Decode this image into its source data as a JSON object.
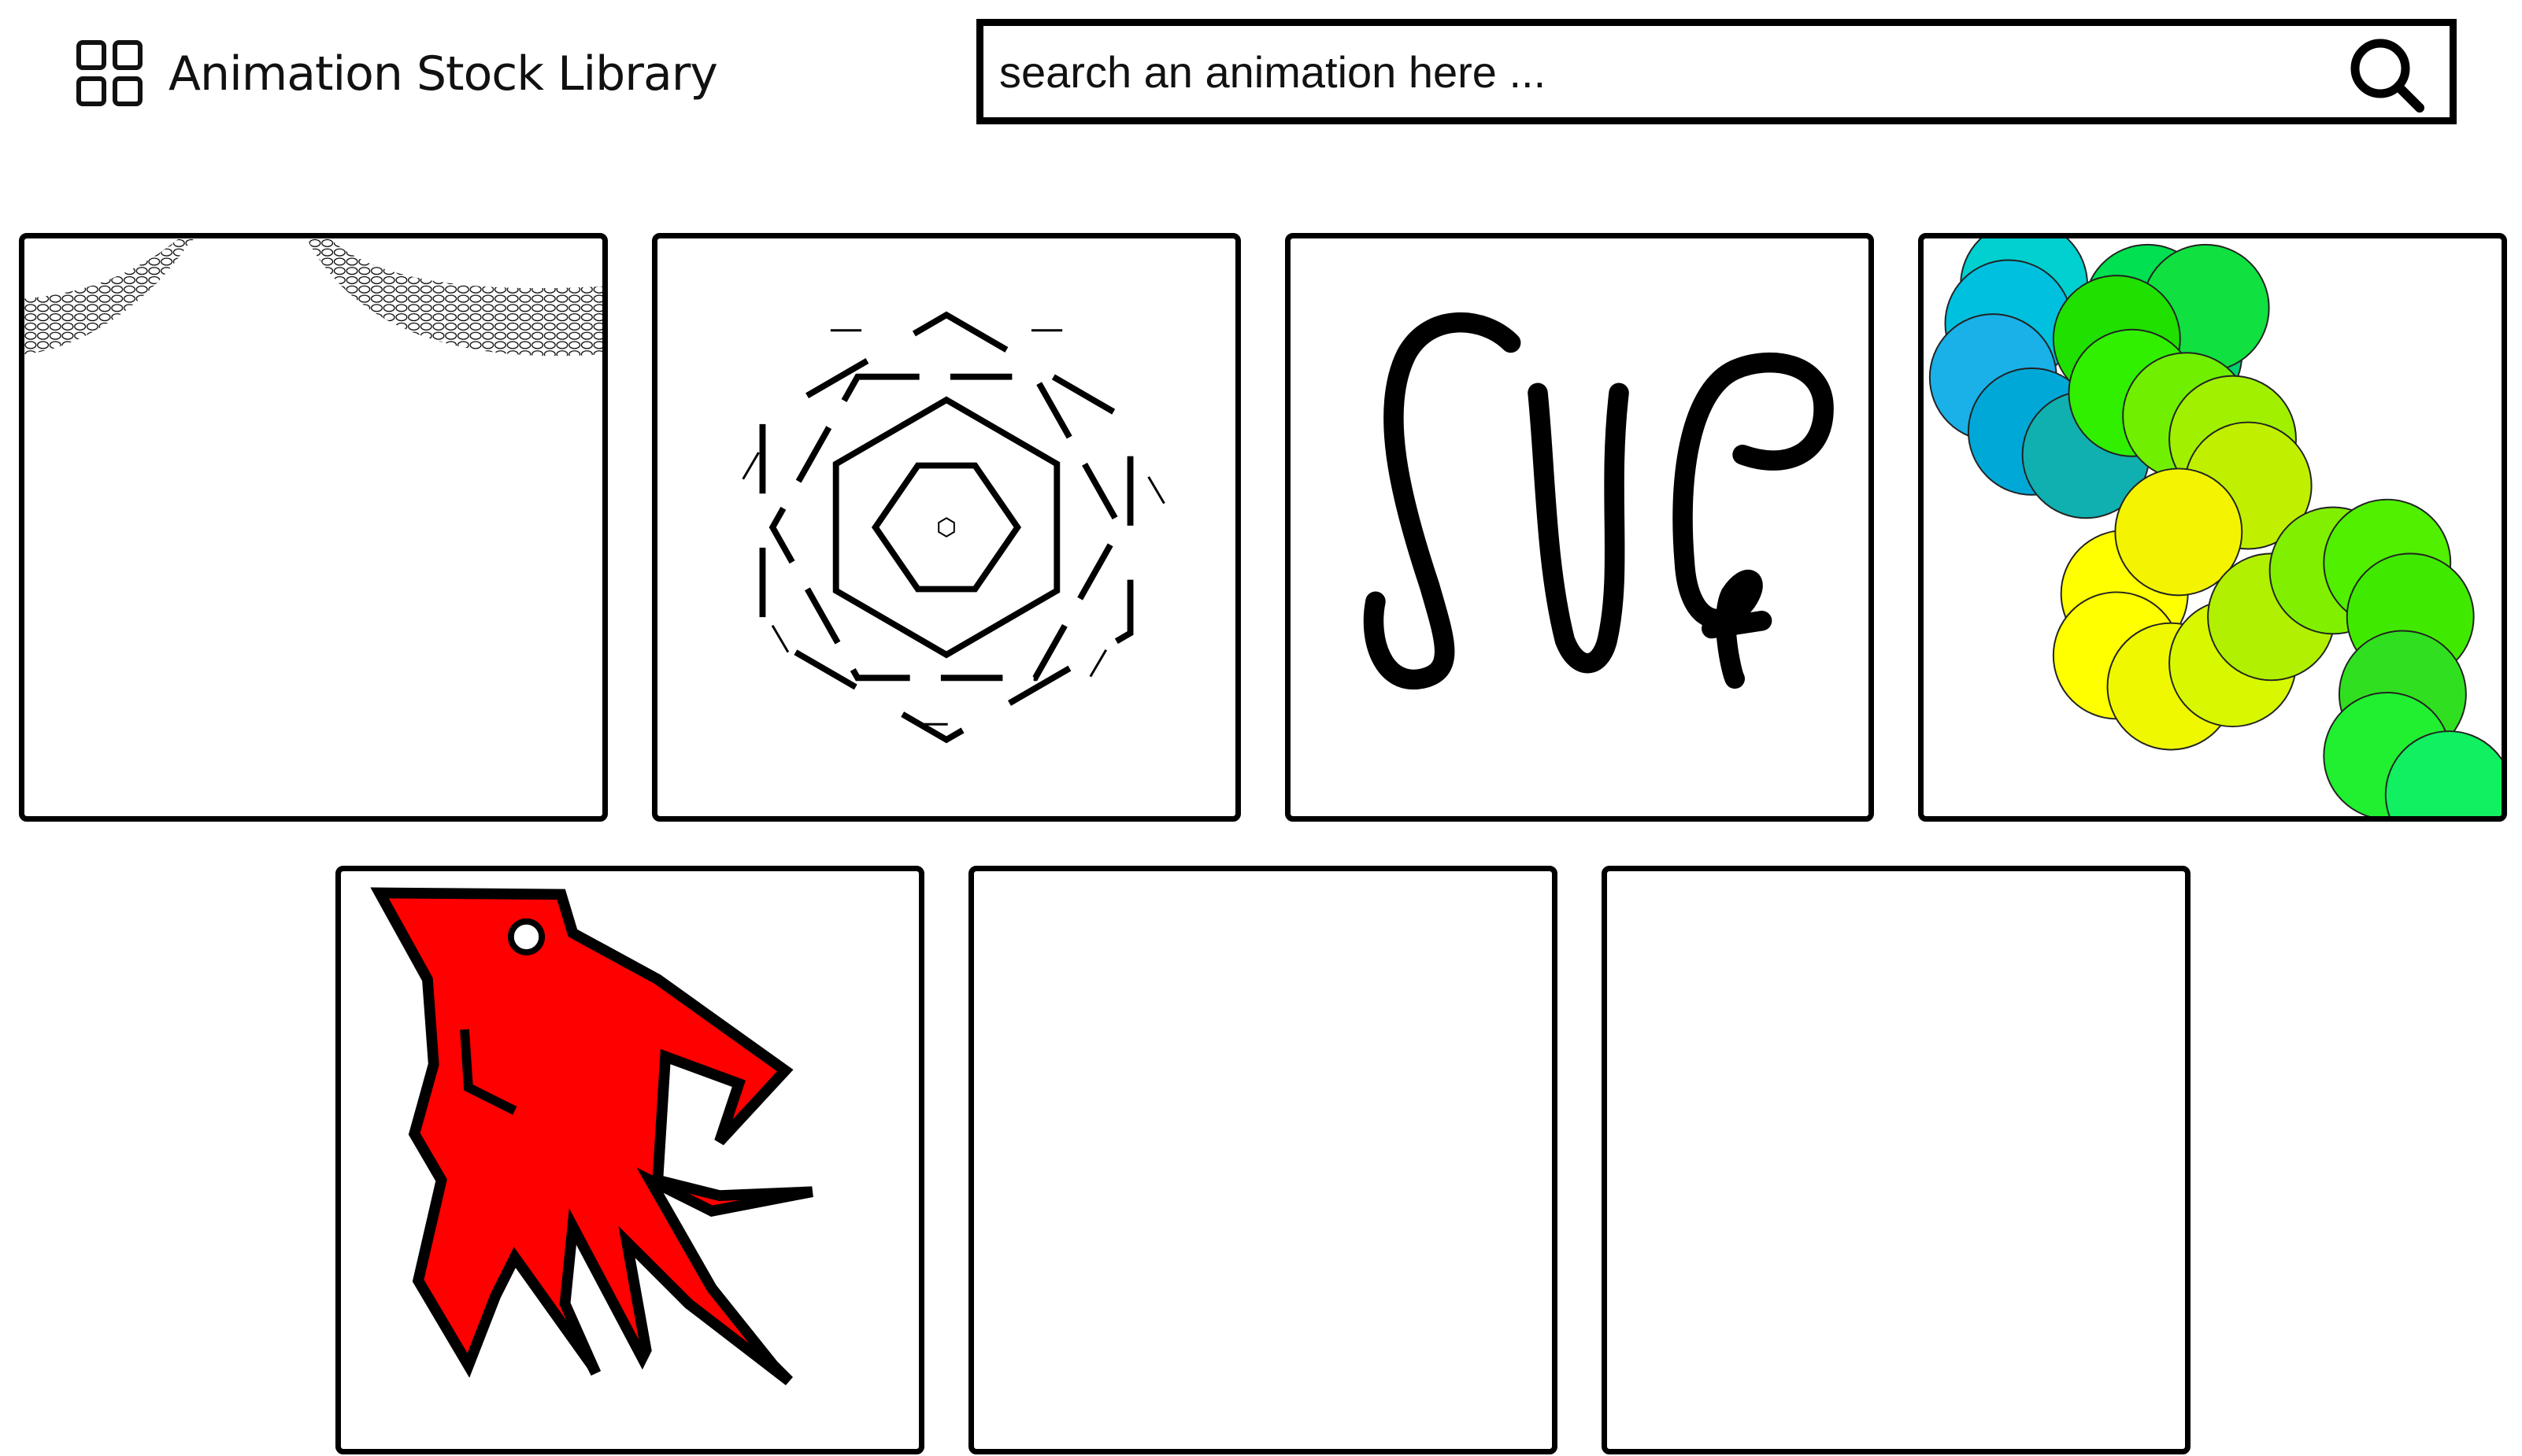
{
  "header": {
    "brand": "Animation Stock Library",
    "logo_icon": "grid-icon"
  },
  "search": {
    "placeholder": "search an animation here ...",
    "value": "",
    "button_icon": "search-icon"
  },
  "gallery": {
    "tiles": [
      {
        "preview": "wavy-texture-arcs"
      },
      {
        "preview": "concentric-hexagons"
      },
      {
        "preview": "svg-handwritten-text",
        "text": "SVG"
      },
      {
        "preview": "colored-circle-spiral"
      },
      {
        "preview": "red-squid-creature",
        "color": "#ff0000"
      },
      {
        "preview": "empty"
      },
      {
        "preview": "empty"
      }
    ]
  },
  "colors": {
    "border": "#000000",
    "background": "#ffffff",
    "squid": "#ff0000"
  }
}
